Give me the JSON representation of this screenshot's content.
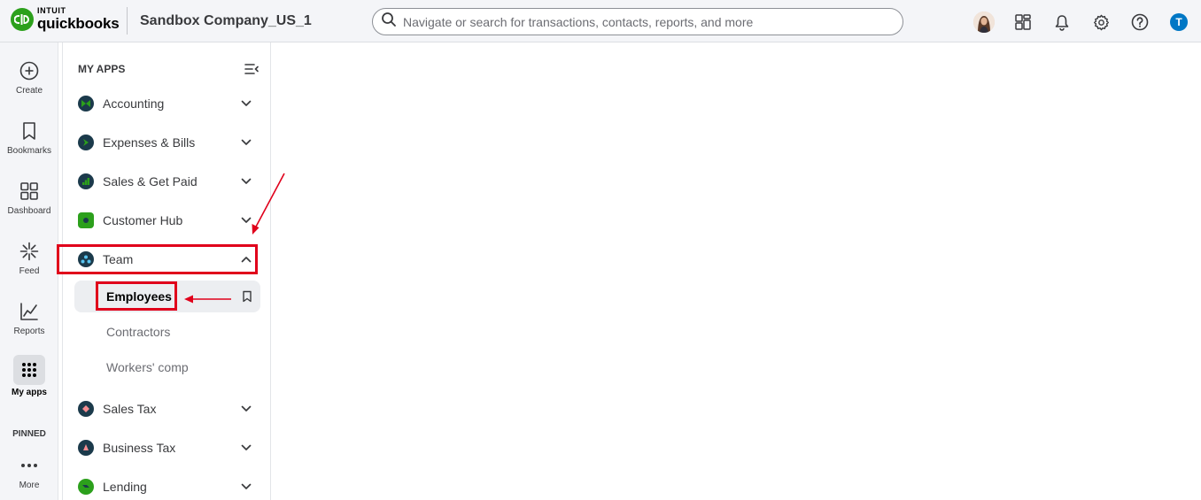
{
  "header": {
    "logo_top": "INTUIT",
    "logo_bottom": "quickbooks",
    "company": "Sandbox Company_US_1",
    "search_placeholder": "Navigate or search for transactions, contacts, reports, and more",
    "user_initial": "T",
    "icons": [
      "user-avatar",
      "apps-switcher-icon",
      "bell-icon",
      "gear-icon",
      "help-icon"
    ]
  },
  "rail": {
    "items": [
      {
        "label": "Create",
        "icon": "plus-circle-icon"
      },
      {
        "label": "Bookmarks",
        "icon": "bookmark-icon"
      },
      {
        "label": "Dashboard",
        "icon": "dashboard-icon"
      },
      {
        "label": "Feed",
        "icon": "sparkle-icon"
      },
      {
        "label": "Reports",
        "icon": "line-chart-icon"
      },
      {
        "label": "My apps",
        "icon": "grid-dots-icon"
      }
    ],
    "pinned_label": "PINNED",
    "more_label": "More"
  },
  "panel": {
    "title": "MY APPS",
    "apps": [
      {
        "label": "Accounting",
        "icon": "accounting-icon"
      },
      {
        "label": "Expenses & Bills",
        "icon": "expenses-icon"
      },
      {
        "label": "Sales & Get Paid",
        "icon": "sales-icon"
      },
      {
        "label": "Customer Hub",
        "icon": "customer-hub-icon"
      },
      {
        "label": "Team",
        "icon": "team-icon",
        "expanded": true
      },
      {
        "label": "Sales Tax",
        "icon": "sales-tax-icon"
      },
      {
        "label": "Business Tax",
        "icon": "business-tax-icon"
      },
      {
        "label": "Lending",
        "icon": "lending-icon"
      }
    ],
    "team_subitems": [
      {
        "label": "Employees",
        "active": true
      },
      {
        "label": "Contractors"
      },
      {
        "label": "Workers' comp"
      }
    ]
  },
  "colors": {
    "brand_green": "#2ca01c",
    "annotation_red": "#e0001b",
    "app_icon_bg": "#1b3a4b"
  }
}
